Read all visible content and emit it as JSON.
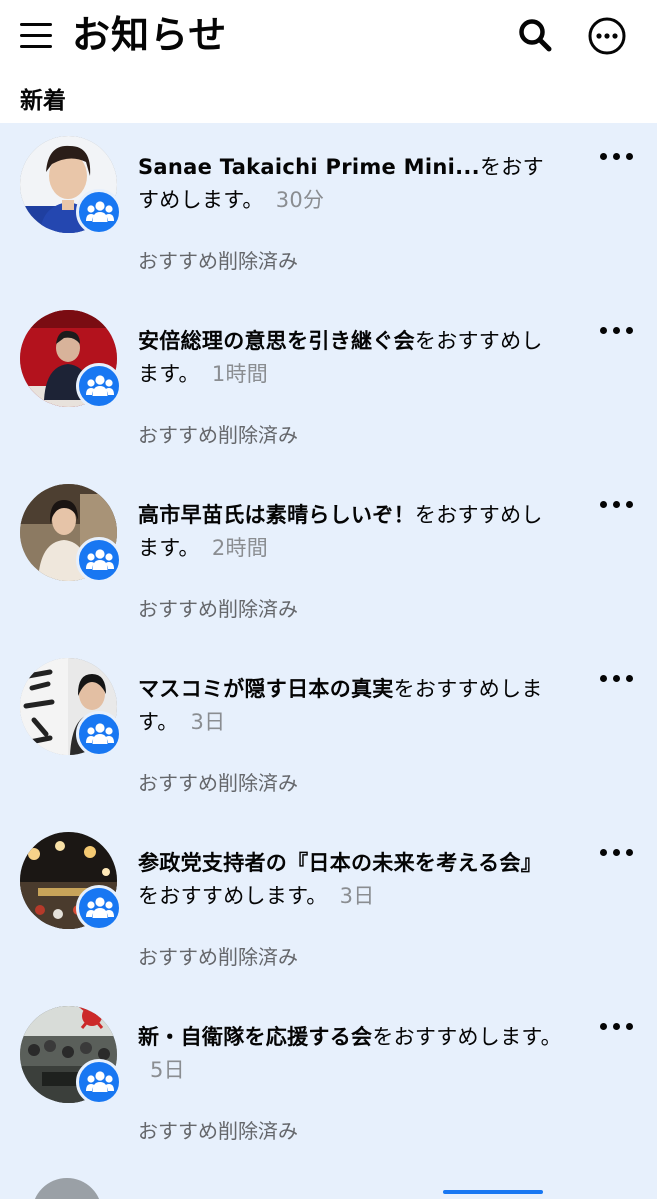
{
  "header": {
    "title": "お知らせ",
    "menu_icon": "hamburger-icon",
    "search_icon": "search-icon",
    "more_icon": "more-circle-icon"
  },
  "section": {
    "title": "新着"
  },
  "notifications": [
    {
      "name": "Sanae Takaichi Prime Mini...",
      "suffix": "をおすすめします。",
      "time": "30分",
      "status": "おすすめ削除済み"
    },
    {
      "name": "安倍総理の意思を引き継ぐ会",
      "suffix": "をおすすめします。",
      "time": "1時間",
      "status": "おすすめ削除済み"
    },
    {
      "name": "高市早苗氏は素晴らしいぞ！",
      "suffix": "をおすすめします。",
      "time": "2時間",
      "status": "おすすめ削除済み"
    },
    {
      "name": "マスコミが隠す日本の真実",
      "suffix": "をおすすめします。",
      "time": "3日",
      "status": "おすすめ削除済み"
    },
    {
      "name": "参政党支持者の『日本の未来を考える会』",
      "suffix": "をおすすめします。",
      "time": "3日",
      "status": "おすすめ削除済み"
    },
    {
      "name": "新・自衛隊を応援する会",
      "suffix": "をおすすめします。",
      "time": "5日",
      "status": "おすすめ削除済み"
    }
  ],
  "colors": {
    "accent": "#1877f2",
    "unread_background": "#e7f0fc",
    "secondary_text": "#65676b",
    "time_text": "#8a8d91"
  }
}
